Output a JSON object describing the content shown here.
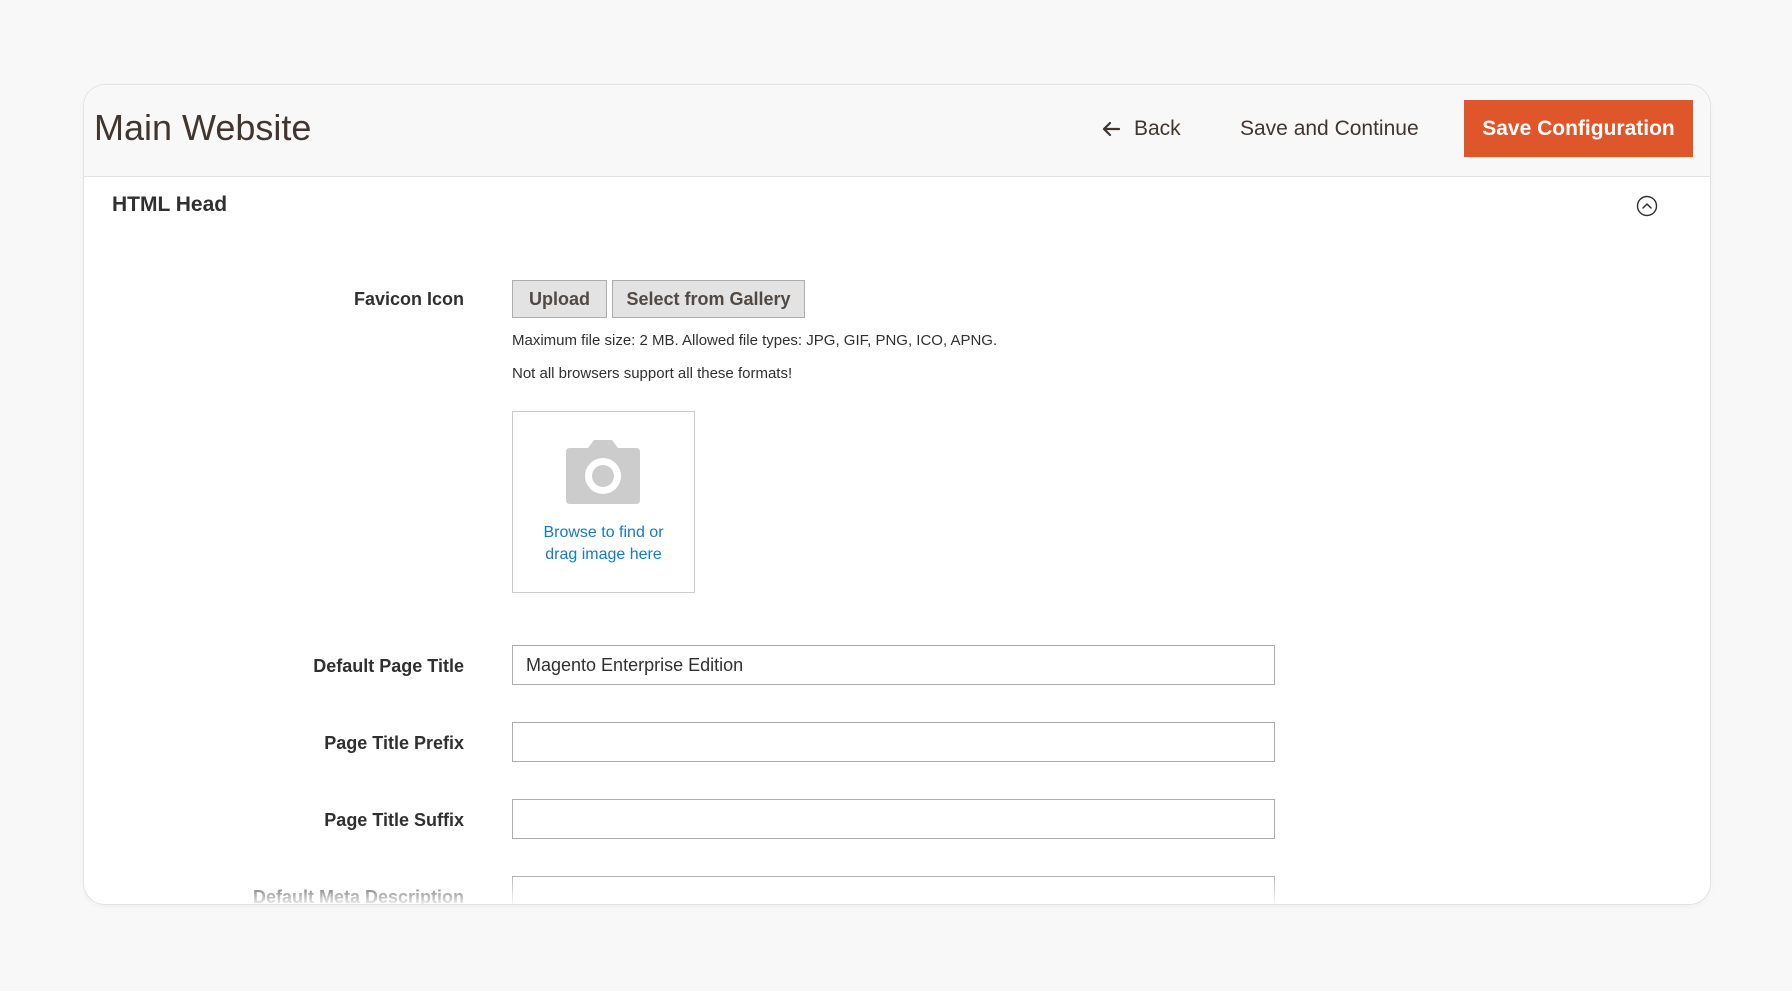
{
  "header": {
    "title": "Main Website",
    "back_label": "Back",
    "save_continue_label": "Save and Continue",
    "save_config_label": "Save Configuration",
    "accent_color": "#e0562b"
  },
  "section": {
    "title": "HTML Head",
    "collapse_icon": "chevron-up-circle-icon"
  },
  "favicon": {
    "label": "Favicon Icon",
    "upload_label": "Upload",
    "gallery_label": "Select from Gallery",
    "note_1": "Maximum file size: 2 MB. Allowed file types: JPG, GIF, PNG, ICO, APNG.",
    "note_2": "Not all browsers support all these formats!",
    "dropzone_line_1": "Browse to find or",
    "dropzone_line_2": "drag image here",
    "dropzone_icon": "camera-icon"
  },
  "fields": {
    "default_page_title": {
      "label": "Default Page Title",
      "value": "Magento Enterprise Edition"
    },
    "page_title_prefix": {
      "label": "Page Title Prefix",
      "value": ""
    },
    "page_title_suffix": {
      "label": "Page Title Suffix",
      "value": ""
    },
    "default_meta_description": {
      "label": "Default Meta Description",
      "value": ""
    }
  }
}
